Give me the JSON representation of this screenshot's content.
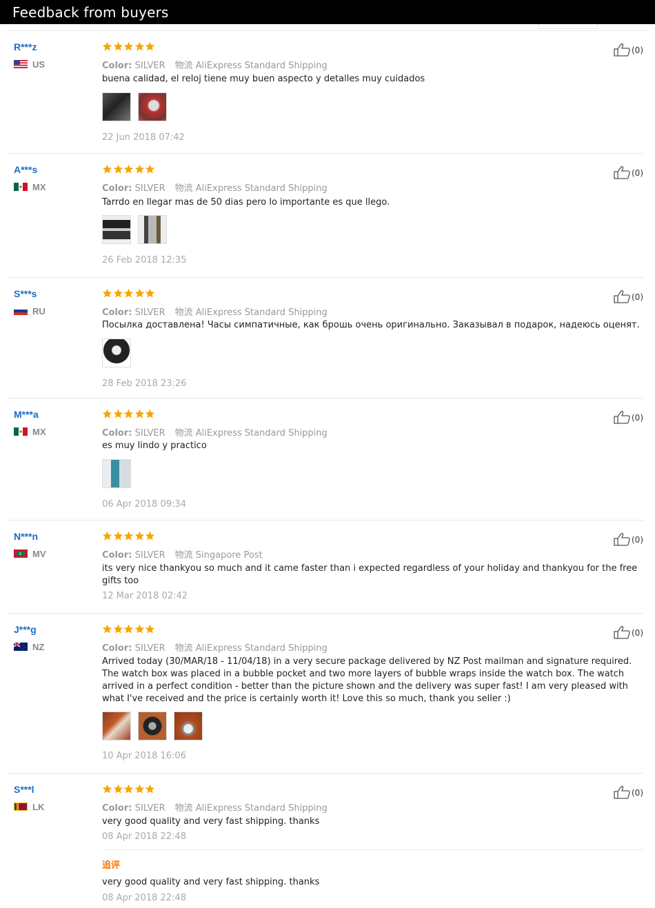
{
  "header": {
    "title": "Feedback from buyers"
  },
  "colors": {
    "star": "#f7a600",
    "username": "#1a6cc8",
    "append": "#ff7700"
  },
  "icons": {
    "rating": "star-icon",
    "helpful": "thumbs-up-icon"
  },
  "reviews": [
    {
      "user": "R***z",
      "country": "US",
      "stars": 5,
      "color_label": "Color:",
      "color": "SILVER",
      "shipping": "物流 AliExpress Standard Shipping",
      "text": "buena calidad, el reloj tiene muy buen aspecto y detalles muy cuidados",
      "photos": 2,
      "date": "22 Jun 2018 07:42",
      "helpful": "(0)"
    },
    {
      "user": "A***s",
      "country": "MX",
      "stars": 5,
      "color_label": "Color:",
      "color": "SILVER",
      "shipping": "物流 AliExpress Standard Shipping",
      "text": "Tarrdo en llegar mas de 50 dias pero lo importante es que llego.",
      "photos": 2,
      "date": "26 Feb 2018 12:35",
      "helpful": "(0)"
    },
    {
      "user": "S***s",
      "country": "RU",
      "stars": 5,
      "color_label": "Color:",
      "color": "SILVER",
      "shipping": "物流 AliExpress Standard Shipping",
      "text": "Посылка доставлена! Часы симпатичные, как брошь очень оригинально. Заказывал в подарок, надеюсь оценят.",
      "photos": 1,
      "date": "28 Feb 2018 23:26",
      "helpful": "(0)"
    },
    {
      "user": "M***a",
      "country": "MX",
      "stars": 5,
      "color_label": "Color:",
      "color": "SILVER",
      "shipping": "物流 AliExpress Standard Shipping",
      "text": "es muy lindo y practico",
      "photos": 1,
      "date": "06 Apr 2018 09:34",
      "helpful": "(0)"
    },
    {
      "user": "N***n",
      "country": "MV",
      "stars": 5,
      "color_label": "Color:",
      "color": "SILVER",
      "shipping": "物流 Singapore Post",
      "text": "its very nice thankyou so much and it came faster than i expected regardless of your holiday and thankyou for the free gifts too",
      "photos": 0,
      "date": "12 Mar 2018 02:42",
      "helpful": "(0)"
    },
    {
      "user": "J***g",
      "country": "NZ",
      "stars": 5,
      "color_label": "Color:",
      "color": "SILVER",
      "shipping": "物流 AliExpress Standard Shipping",
      "text": "Arrived today (30/MAR/18 - 11/04/18) in a very secure package delivered by NZ Post mailman and signature required. The watch box was placed in a bubble pocket and two more layers of bubble wraps inside the watch box. The watch arrived in a perfect condition - better than the picture shown and the delivery was super fast! I am very pleased with what I've received and the price is certainly worth it! Love this so much, thank you seller :)",
      "photos": 3,
      "date": "10 Apr 2018 16:06",
      "helpful": "(0)"
    },
    {
      "user": "S***l",
      "country": "LK",
      "stars": 5,
      "color_label": "Color:",
      "color": "SILVER",
      "shipping": "物流 AliExpress Standard Shipping",
      "text": "very good quality and very fast shipping. thanks",
      "photos": 0,
      "date": "08 Apr 2018 22:48",
      "helpful": "(0)",
      "append_label": "追评",
      "append_text": "very good quality and very fast shipping. thanks",
      "append_date": "08 Apr 2018 22:48"
    }
  ]
}
